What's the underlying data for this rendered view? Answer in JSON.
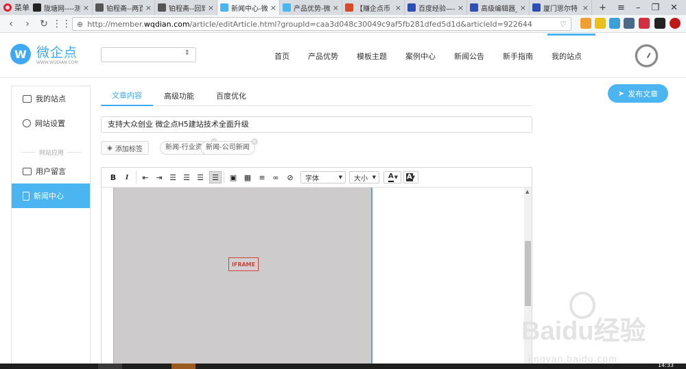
{
  "browser": {
    "menu_label": "菜单",
    "tabs": [
      {
        "label": "陇塘网----测",
        "color": "#222"
      },
      {
        "label": "铂程斋--两百",
        "color": "#555"
      },
      {
        "label": "铂程斋--回到",
        "color": "#555"
      },
      {
        "label": "新闻中心-微",
        "color": "#4ab5f0"
      },
      {
        "label": "产品优势-微",
        "color": "#4ab5f0"
      },
      {
        "label": "【赚企点币",
        "color": "#d84a2a"
      },
      {
        "label": "百度经验——",
        "color": "#2f4eb5"
      },
      {
        "label": "高级编辑器_",
        "color": "#2f4eb5"
      },
      {
        "label": "厦门思尔特",
        "color": "#2f4eb5"
      }
    ],
    "new_tab": "+",
    "url_prefix": "http://member.",
    "url_domain": "wqdian.com",
    "url_rest": "/article/editArticle.html?groupId=caa3d048c30049c9af5fb281dfed5d1d&articleId=922644"
  },
  "site": {
    "brand": "微企点",
    "brand_url": "WWW.WQDIAN.COM",
    "nav": [
      "首页",
      "产品优势",
      "模板主题",
      "案例中心",
      "新闻公告",
      "新手指南",
      "我的站点"
    ],
    "sidebar": {
      "items": [
        {
          "label": "我的站点"
        },
        {
          "label": "网站设置"
        },
        {
          "label": "用户留言"
        },
        {
          "label": "新闻中心"
        }
      ],
      "divider": "网站应用"
    },
    "tabs": [
      "文章内容",
      "高级功能",
      "百度优化"
    ],
    "publish": "发布文章",
    "title_value": "支持大众创业 微企点H5建站技术全面升级",
    "add_tag": "添加标签",
    "tags": [
      "新闻-行业资讯",
      "新闻-公司新闻"
    ],
    "toolbar": {
      "bold": "B",
      "italic": "I",
      "font": "字体",
      "size": "大小",
      "font_color": "A",
      "bg_color": "A"
    },
    "iframe_label": "IFRAME"
  },
  "watermark": {
    "big": "Baidu经验",
    "small": "jingyan.baidu.com"
  },
  "clock": "14:33"
}
